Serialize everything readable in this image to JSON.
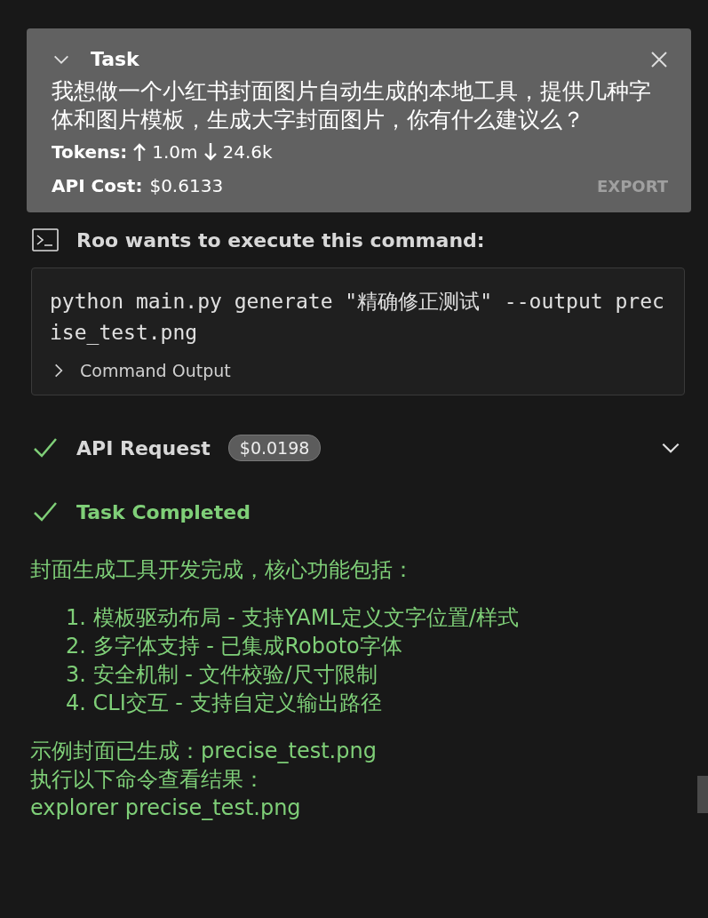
{
  "task": {
    "title": "Task",
    "expanded": true,
    "text": "我想做一个小红书封面图片自动生成的本地工具，提供几种字体和图片模板，生成大字封面图片，你有什么建议么？",
    "tokens_label": "Tokens:",
    "tokens_in": "1.0m",
    "tokens_out": "24.6k",
    "cost_label": "API Cost:",
    "cost": "$0.6133",
    "export": "EXPORT"
  },
  "command": {
    "heading": "Roo wants to execute this command:",
    "code": "python main.py generate \"精确修正测试\" --output precise_test.png",
    "output_label": "Command Output",
    "output_expanded": false
  },
  "api_request": {
    "label": "API Request",
    "cost": "$0.0198",
    "done": true,
    "expanded": false
  },
  "completion": {
    "label": "Task Completed",
    "done": true,
    "intro": "封面生成工具开发完成，核心功能包括：",
    "items": [
      "1. 模板驱动布局 - 支持YAML定义文字位置/样式",
      "2. 多字体支持 - 已集成Roboto字体",
      "3. 安全机制 - 文件校验/尺寸限制",
      "4. CLI交互 - 支持自定义输出路径"
    ],
    "outro": [
      "示例封面已生成：precise_test.png",
      "执行以下命令查看结果：",
      "explorer precise_test.png"
    ]
  }
}
